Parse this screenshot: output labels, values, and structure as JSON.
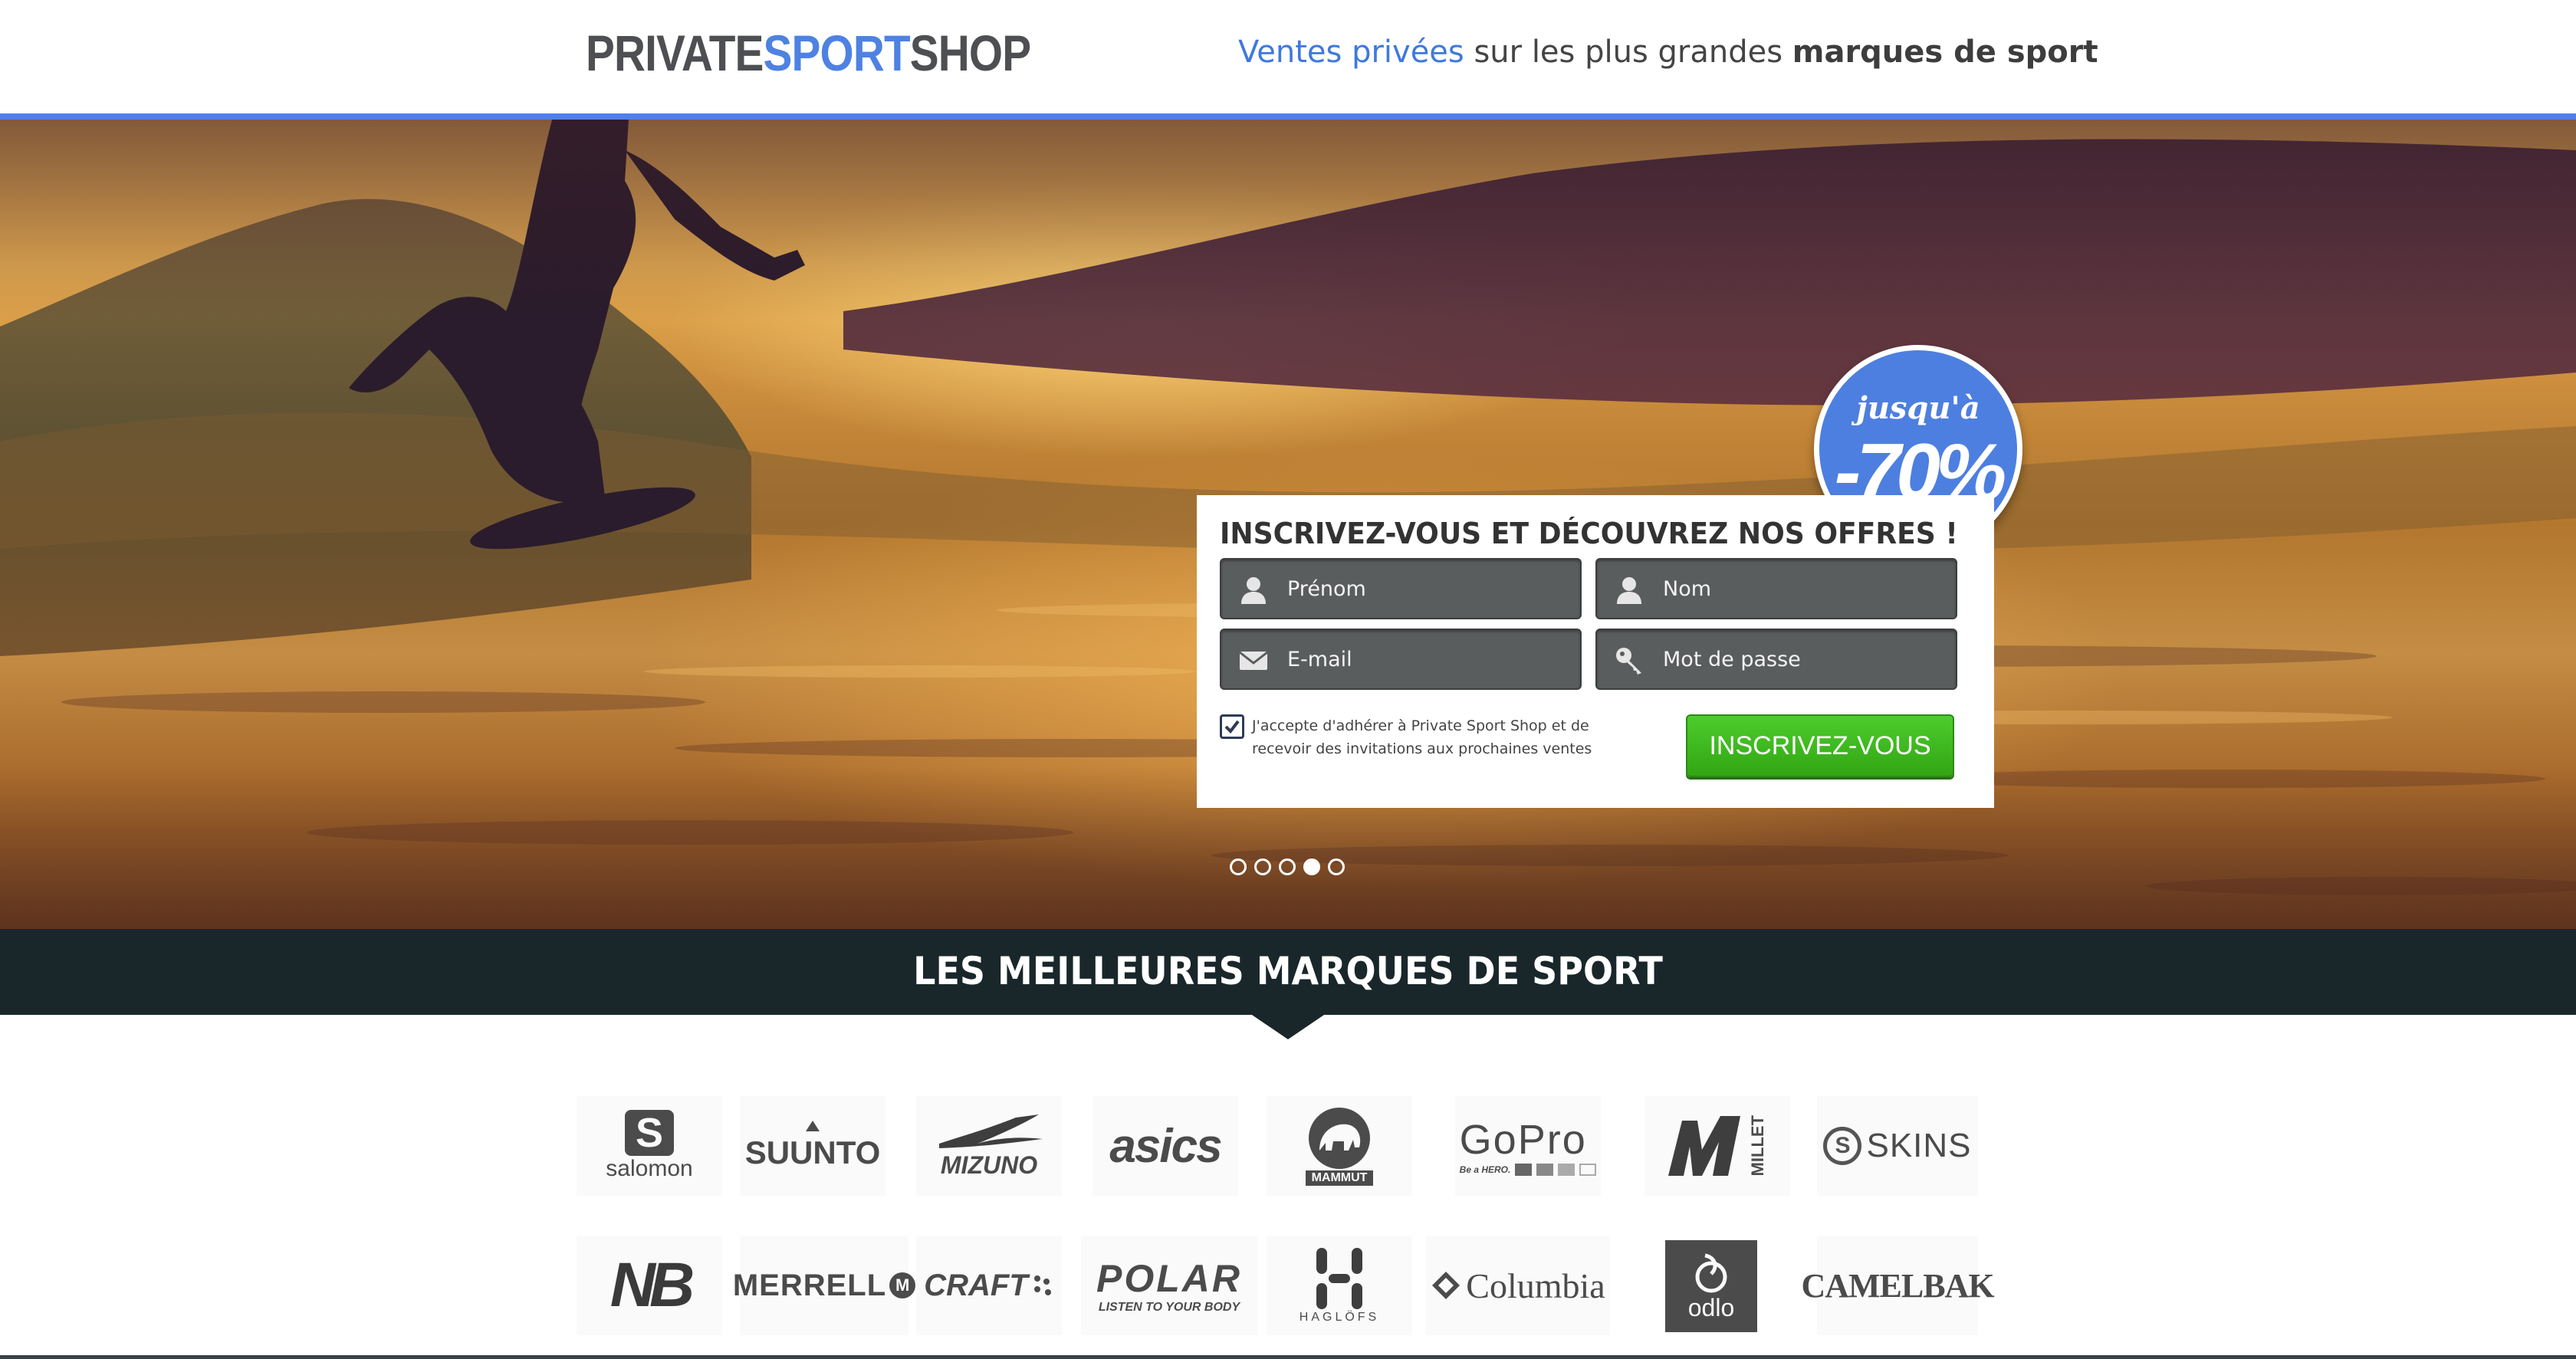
{
  "header": {
    "logo": {
      "part1": "PRIVATE",
      "part2": "SPORT",
      "part3": "SHOP"
    },
    "tagline": {
      "highlight": "Ventes privées",
      "middle": " sur les plus grandes ",
      "bold": "marques de sport"
    }
  },
  "hero": {
    "badge": {
      "line1": "jusqu'à",
      "line2": "-70%"
    },
    "signup": {
      "title": "INSCRIVEZ-VOUS ET DÉCOUVREZ NOS OFFRES !",
      "fields": {
        "first_name": {
          "placeholder": "Prénom",
          "icon": "user-icon"
        },
        "last_name": {
          "placeholder": "Nom",
          "icon": "user-icon"
        },
        "email": {
          "placeholder": "E-mail",
          "icon": "envelope-icon"
        },
        "password": {
          "placeholder": "Mot de passe",
          "icon": "key-icon"
        }
      },
      "consent": "J'accepte d'adhérer à Private Sport Shop et de recevoir des invitations aux prochaines ventes",
      "consent_checked": true,
      "submit_label": "INSCRIVEZ-VOUS"
    },
    "carousel": {
      "slide_count": 5,
      "active_index": 3
    }
  },
  "brands_section": {
    "title": "LES MEILLEURES MARQUES DE SPORT",
    "row1": [
      "salomon",
      "SUUNTO",
      "MIZUNO",
      "asics",
      "MAMMUT",
      "GoPro",
      "MILLET",
      "SKINS"
    ],
    "row2": [
      "NB",
      "MERRELL",
      "CRAFT",
      "POLAR",
      "HAGLÖFS",
      "Columbia",
      "odlo",
      "CAMELBAK"
    ],
    "extra_text": {
      "gopro_sub": "Be a HERO.",
      "polar_sub": "LISTEN TO YOUR BODY"
    }
  },
  "colors": {
    "brand_blue": "#4e82e2",
    "band_dark": "#19272b",
    "cta_green": "#3cb61c",
    "field_grey": "#5a5d5e"
  }
}
